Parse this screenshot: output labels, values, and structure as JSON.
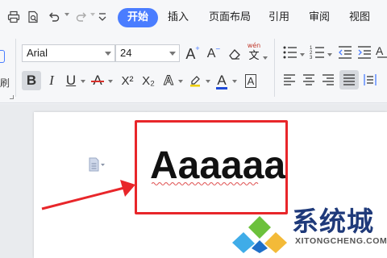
{
  "menu": {
    "tabs": [
      {
        "label": "开始",
        "active": true
      },
      {
        "label": "插入"
      },
      {
        "label": "页面布局"
      },
      {
        "label": "引用"
      },
      {
        "label": "审阅"
      },
      {
        "label": "视图"
      }
    ],
    "accent": "#4a7dff"
  },
  "ribbon": {
    "font_name": "Arial",
    "font_size": "24",
    "left_edge_char": "刷",
    "grow_font": "A",
    "shrink_font": "A",
    "phonetic_top": "wén",
    "phonetic_bottom": "文",
    "bold": "B",
    "italic": "I",
    "underline": "U",
    "strikethrough": "A",
    "superscript": "X²",
    "subscript": "X₂",
    "text_effect": "A",
    "font_color": "A",
    "char_border": "A",
    "font_color_value": "#1f4bd8",
    "highlight_color_value": "#f0d000",
    "strike_color_value": "#d9302a"
  },
  "document": {
    "text": "Aaaaaa",
    "annotation_color": "#e8262a"
  },
  "watermark": {
    "brand_cn": "系统城",
    "brand_en": "XITONGCHENG.COM"
  }
}
